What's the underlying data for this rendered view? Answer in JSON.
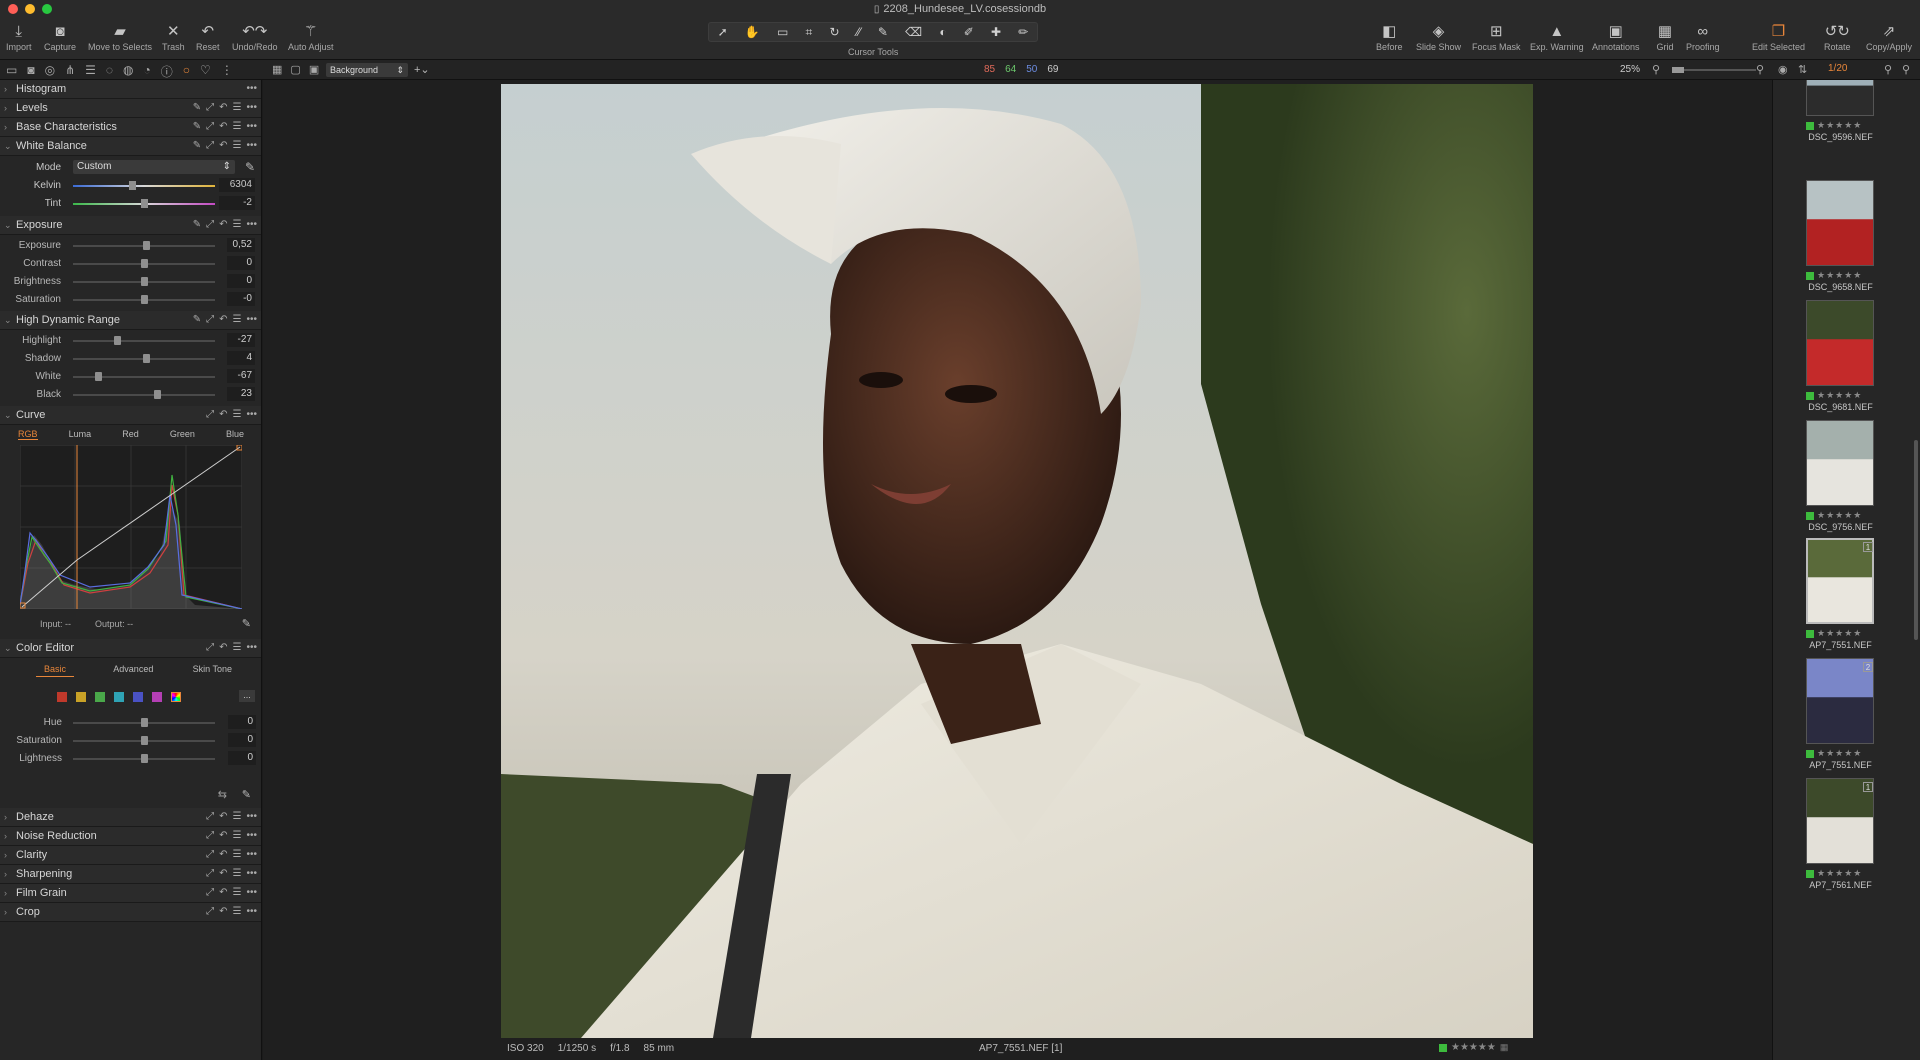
{
  "window": {
    "title": "2208_Hundesee_LV.cosessiondb"
  },
  "toolbar": {
    "left": [
      {
        "label": "Import",
        "icon": "import-icon"
      },
      {
        "label": "Capture",
        "icon": "camera-icon"
      },
      {
        "label": "Move to Selects",
        "icon": "move-folder-icon"
      },
      {
        "label": "Trash",
        "icon": "trash-icon"
      },
      {
        "label": "Reset",
        "icon": "reset-icon"
      },
      {
        "label": "Undo/Redo",
        "icon": "undo-redo-icon"
      },
      {
        "label": "Auto Adjust",
        "icon": "magic-wand-icon"
      }
    ],
    "cursor_tools_label": "Cursor Tools",
    "right": [
      {
        "label": "Before",
        "icon": "before-icon"
      },
      {
        "label": "Slide Show",
        "icon": "slideshow-icon"
      },
      {
        "label": "Focus Mask",
        "icon": "focus-mask-icon"
      },
      {
        "label": "Exp. Warning",
        "icon": "warning-icon"
      },
      {
        "label": "Annotations",
        "icon": "annotation-icon"
      },
      {
        "label": "Grid",
        "icon": "grid-icon"
      },
      {
        "label": "Proofing",
        "icon": "glasses-icon"
      },
      {
        "label": "Edit Selected",
        "icon": "edit-selected-icon"
      },
      {
        "label": "Rotate",
        "icon": "rotate-icon"
      },
      {
        "label": "Copy/Apply",
        "icon": "copy-apply-icon"
      }
    ]
  },
  "subbar": {
    "layer": "Background",
    "rgb": {
      "r": "85",
      "g": "64",
      "b": "50",
      "l": "69"
    },
    "zoom": "25%",
    "counter": "1/20"
  },
  "tools": {
    "histogram": "Histogram",
    "levels": "Levels",
    "base": "Base Characteristics",
    "wb": {
      "title": "White Balance",
      "mode_label": "Mode",
      "mode_value": "Custom",
      "kelvin_label": "Kelvin",
      "kelvin": "6304",
      "tint_label": "Tint",
      "tint": "-2"
    },
    "exposure": {
      "title": "Exposure",
      "rows": [
        {
          "label": "Exposure",
          "value": "0,52",
          "pos": 0.52
        },
        {
          "label": "Contrast",
          "value": "0",
          "pos": 0.5
        },
        {
          "label": "Brightness",
          "value": "0",
          "pos": 0.5
        },
        {
          "label": "Saturation",
          "value": "-0",
          "pos": 0.5
        }
      ]
    },
    "hdr": {
      "title": "High Dynamic Range",
      "rows": [
        {
          "label": "Highlight",
          "value": "-27",
          "pos": 0.3
        },
        {
          "label": "Shadow",
          "value": "4",
          "pos": 0.52
        },
        {
          "label": "White",
          "value": "-67",
          "pos": 0.16
        },
        {
          "label": "Black",
          "value": "23",
          "pos": 0.6
        }
      ]
    },
    "curve": {
      "title": "Curve",
      "tabs": [
        "RGB",
        "Luma",
        "Red",
        "Green",
        "Blue"
      ],
      "input_label": "Input:",
      "input_value": "--",
      "output_label": "Output:",
      "output_value": "--"
    },
    "color_editor": {
      "title": "Color Editor",
      "tabs": [
        "Basic",
        "Advanced",
        "Skin Tone"
      ],
      "swatches": [
        "#c0392b",
        "#c9a227",
        "#4aa84a",
        "#2fa3b5",
        "#4a52c4",
        "#b43fb4"
      ],
      "more": "...",
      "rows": [
        {
          "label": "Hue",
          "value": "0",
          "pos": 0.5
        },
        {
          "label": "Saturation",
          "value": "0",
          "pos": 0.5
        },
        {
          "label": "Lightness",
          "value": "0",
          "pos": 0.5
        }
      ]
    },
    "collapsed": [
      "Dehaze",
      "Noise Reduction",
      "Clarity",
      "Sharpening",
      "Film Grain",
      "Crop"
    ]
  },
  "status": {
    "iso": "ISO 320",
    "shutter": "1/1250 s",
    "aperture": "f/1.8",
    "focal": "85 mm",
    "filename": "AP7_7551.NEF [1]"
  },
  "thumbnails": [
    {
      "name": "DSC_9596.NEF",
      "badge": ""
    },
    {
      "name": "DSC_9658.NEF",
      "badge": ""
    },
    {
      "name": "DSC_9681.NEF",
      "badge": ""
    },
    {
      "name": "DSC_9756.NEF",
      "badge": ""
    },
    {
      "name": "AP7_7551.NEF",
      "badge": "1"
    },
    {
      "name": "AP7_7551.NEF",
      "badge": "2"
    },
    {
      "name": "AP7_7561.NEF",
      "badge": "1"
    }
  ]
}
